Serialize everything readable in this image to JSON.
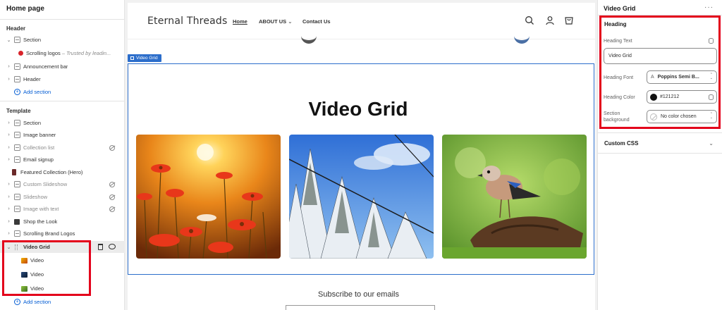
{
  "left_panel": {
    "title": "Home page",
    "header_group": "Header",
    "header_items": [
      {
        "label": "Section"
      },
      {
        "label": "Scrolling logos",
        "suffix": " – Trusted by leadin..."
      },
      {
        "label": "Announcement bar"
      },
      {
        "label": "Header"
      }
    ],
    "add_section": "Add section",
    "template_group": "Template",
    "template_items": [
      {
        "label": "Section",
        "hidden": false
      },
      {
        "label": "Image banner",
        "hidden": false
      },
      {
        "label": "Collection list",
        "hidden": true
      },
      {
        "label": "Email signup",
        "hidden": false
      },
      {
        "label": "Featured Collection (Hero)",
        "hidden": false
      },
      {
        "label": "Custom Slideshow",
        "hidden": true
      },
      {
        "label": "Slideshow",
        "hidden": true
      },
      {
        "label": "Image with text",
        "hidden": true
      },
      {
        "label": "Shop the Look",
        "hidden": false
      },
      {
        "label": "Scrolling Brand Logos",
        "hidden": false
      }
    ],
    "selected_section": "Video Grid",
    "video_blocks": [
      "Video",
      "Video",
      "Video"
    ],
    "add_section_bottom": "Add section"
  },
  "preview": {
    "store_name": "Eternal Threads",
    "nav": [
      "Home",
      "ABOUT US",
      "Contact Us"
    ],
    "section_tag": "Video Grid",
    "heading": "Video Grid",
    "tiles": [
      "flowers-sunset",
      "snowy-trees",
      "bird-on-log"
    ],
    "subscribe": "Subscribe to our emails"
  },
  "right_panel": {
    "title": "Video Grid",
    "heading_group": "Heading",
    "heading_text_label": "Heading Text",
    "heading_text_value": "Video Grid",
    "heading_font_label": "Heading Font",
    "heading_font_value": "Poppins Semi B...",
    "heading_color_label": "Heading Color",
    "heading_color_value": "#121212",
    "section_background_label": "Section background",
    "section_background_value": "No color chosen",
    "custom_css": "Custom CSS"
  },
  "colors": {
    "accent": "#005bd3",
    "highlight": "#e3001b",
    "heading_color": "#121212"
  }
}
